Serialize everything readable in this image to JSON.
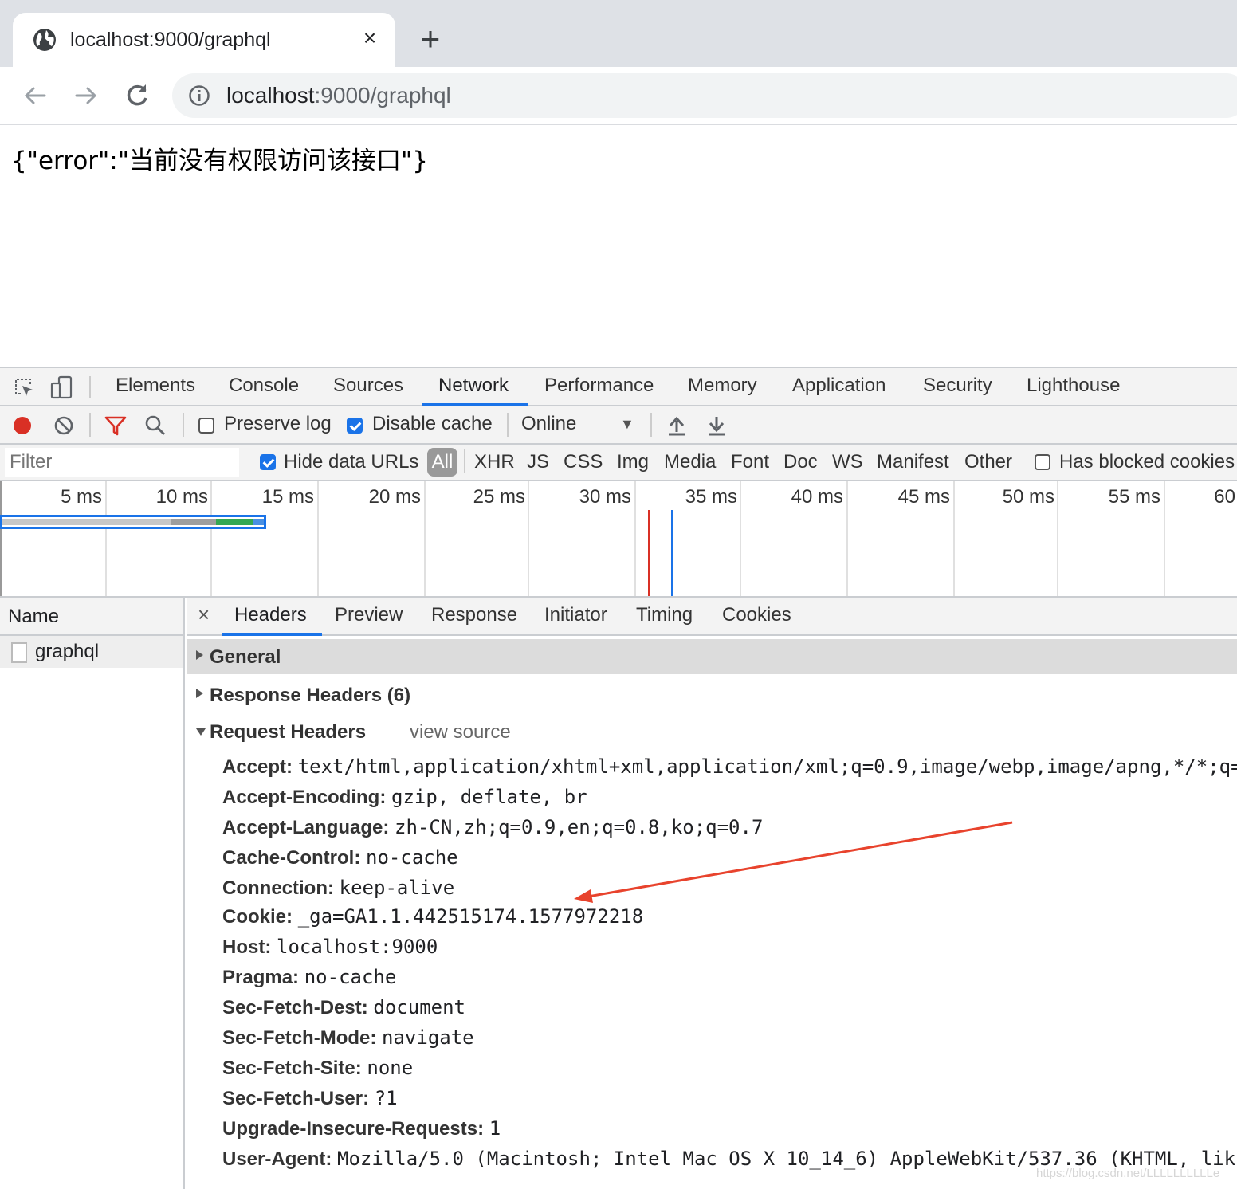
{
  "browser": {
    "tab_title": "localhost:9000/graphql",
    "tab_close": "×",
    "new_tab": "+",
    "url_host": "localhost",
    "url_rest": ":9000/graphql"
  },
  "page": {
    "body_text": "{\"error\":\"当前没有权限访问该接口\"}"
  },
  "devtools": {
    "tabs": [
      "Elements",
      "Console",
      "Sources",
      "Network",
      "Performance",
      "Memory",
      "Application",
      "Security",
      "Lighthouse"
    ],
    "active_tab": "Network",
    "network_toolbar": {
      "preserve_log": "Preserve log",
      "disable_cache": "Disable cache",
      "throttle": "Online",
      "throttle_caret": "▼"
    },
    "filter": {
      "placeholder": "Filter",
      "hide_data_urls": "Hide data URLs",
      "types": [
        "All",
        "XHR",
        "JS",
        "CSS",
        "Img",
        "Media",
        "Font",
        "Doc",
        "WS",
        "Manifest",
        "Other"
      ],
      "has_blocked_cookies": "Has blocked cookies"
    },
    "timeline_ticks": [
      "5 ms",
      "10 ms",
      "15 ms",
      "20 ms",
      "25 ms",
      "30 ms",
      "35 ms",
      "40 ms",
      "45 ms",
      "50 ms",
      "55 ms",
      "60"
    ],
    "name_column": {
      "header": "Name",
      "rows": [
        "graphql"
      ]
    },
    "details": {
      "close": "×",
      "tabs": [
        "Headers",
        "Preview",
        "Response",
        "Initiator",
        "Timing",
        "Cookies"
      ],
      "active_tab": "Headers",
      "general": "General",
      "response_headers": "Response Headers (6)",
      "request_headers": "Request Headers",
      "view_source": "view source",
      "request_header_list": [
        {
          "key": "Accept:",
          "value": "text/html,application/xhtml+xml,application/xml;q=0.9,image/webp,image/apng,*/*;q="
        },
        {
          "key": "Accept-Encoding:",
          "value": "gzip, deflate, br"
        },
        {
          "key": "Accept-Language:",
          "value": "zh-CN,zh;q=0.9,en;q=0.8,ko;q=0.7"
        },
        {
          "key": "Cache-Control:",
          "value": "no-cache"
        },
        {
          "key": "Connection:",
          "value": "keep-alive"
        },
        {
          "key": "Cookie:",
          "value": "_ga=GA1.1.442515174.1577972218"
        },
        {
          "key": "Host:",
          "value": "localhost:9000"
        },
        {
          "key": "Pragma:",
          "value": "no-cache"
        },
        {
          "key": "Sec-Fetch-Dest:",
          "value": "document"
        },
        {
          "key": "Sec-Fetch-Mode:",
          "value": "navigate"
        },
        {
          "key": "Sec-Fetch-Site:",
          "value": "none"
        },
        {
          "key": "Sec-Fetch-User:",
          "value": "?1"
        },
        {
          "key": "Upgrade-Insecure-Requests:",
          "value": "1"
        },
        {
          "key": "User-Agent:",
          "value": "Mozilla/5.0 (Macintosh; Intel Mac OS X 10_14_6) AppleWebKit/537.36 (KHTML, lik"
        }
      ]
    }
  },
  "annotation_color": "#e8432d",
  "watermark": "https://blog.csdn.net/LLLLLLLLLLe"
}
